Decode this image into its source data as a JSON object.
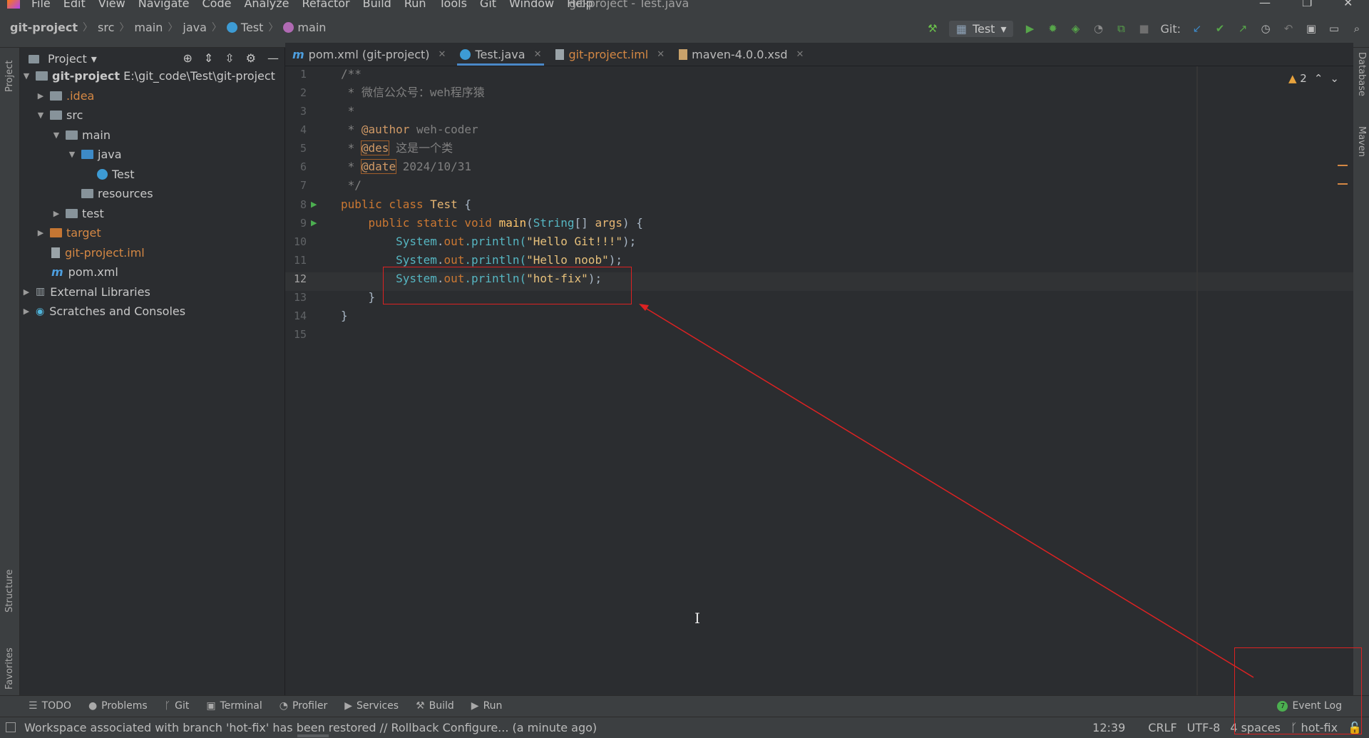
{
  "window": {
    "title": "git-project - Test.java",
    "menu": [
      "File",
      "Edit",
      "View",
      "Navigate",
      "Code",
      "Analyze",
      "Refactor",
      "Build",
      "Run",
      "Tools",
      "Git",
      "Window",
      "Help"
    ]
  },
  "breadcrumb": [
    "git-project",
    "src",
    "main",
    "java",
    "Test",
    "main"
  ],
  "toolbar": {
    "run_config": "Test",
    "git_label": "Git:"
  },
  "project_panel": {
    "title": "Project",
    "tree": [
      {
        "label": "git-project",
        "extra": "E:\\git_code\\Test\\git-project"
      },
      {
        "label": ".idea"
      },
      {
        "label": "src"
      },
      {
        "label": "main"
      },
      {
        "label": "java"
      },
      {
        "label": "Test"
      },
      {
        "label": "resources"
      },
      {
        "label": "test"
      },
      {
        "label": "target"
      },
      {
        "label": "git-project.iml"
      },
      {
        "label": "pom.xml"
      },
      {
        "label": "External Libraries"
      },
      {
        "label": "Scratches and Consoles"
      }
    ]
  },
  "tabs": [
    {
      "label": "pom.xml (git-project)"
    },
    {
      "label": "Test.java"
    },
    {
      "label": "git-project.iml"
    },
    {
      "label": "maven-4.0.0.xsd"
    }
  ],
  "editor": {
    "line_numbers": [
      "1",
      "2",
      "3",
      "4",
      "5",
      "6",
      "7",
      "8",
      "9",
      "10",
      "11",
      "12",
      "13",
      "14",
      "15"
    ],
    "current_line": "12",
    "warning_count": "2",
    "code": {
      "l1": "/**",
      "l2": " * 微信公众号：weh程序猿",
      "l3": " *",
      "l4_pre": " * ",
      "l4_tag": "@author",
      "l4_val": " weh-coder",
      "l5_pre": " * ",
      "l5_tag": "@des",
      "l5_val": " 这是一个类",
      "l6_pre": " * ",
      "l6_tag": "@date",
      "l6_val": " 2024/10/31",
      "l7": " */",
      "l8_kw": "public class ",
      "l8_cls": "Test",
      "l8_end": " {",
      "l9_kw": "    public static void ",
      "l9_fn": "main",
      "l9_p1": "(",
      "l9_type": "String",
      "l9_p2": "[] ",
      "l9_arg": "args",
      "l9_end": ") {",
      "l10_sys": "        System",
      "l10_dot": ".",
      "l10_out": "out",
      "l10_pl": ".println(",
      "l10_str": "\"Hello Git!!!\"",
      "l10_end": ");",
      "l11_sys": "        System",
      "l11_dot": ".",
      "l11_out": "out",
      "l11_pl": ".println(",
      "l11_str": "\"Hello noob\"",
      "l11_end": ");",
      "l12_sys": "        System",
      "l12_dot": ".",
      "l12_out": "out",
      "l12_pl": ".println(",
      "l12_str": "\"hot-fix\"",
      "l12_end": ");",
      "l13": "    }",
      "l14": "}"
    }
  },
  "side_tabs": {
    "left": [
      "Project",
      "Structure",
      "Favorites"
    ],
    "right": [
      "Database",
      "Maven"
    ]
  },
  "bottom_tools": [
    "TODO",
    "Problems",
    "Git",
    "Terminal",
    "Profiler",
    "Services",
    "Build",
    "Run"
  ],
  "event_log": {
    "label": "Event Log",
    "badge": "7"
  },
  "status": {
    "message": "Workspace associated with branch 'hot-fix' has been restored // Rollback   Configure... (a minute ago)",
    "position": "12:39",
    "line_sep": "CRLF",
    "encoding": "UTF-8",
    "indent": "4 spaces",
    "branch": "hot-fix"
  },
  "colors": {
    "annotation": "#dd2222",
    "accent": "#4a88c7"
  }
}
